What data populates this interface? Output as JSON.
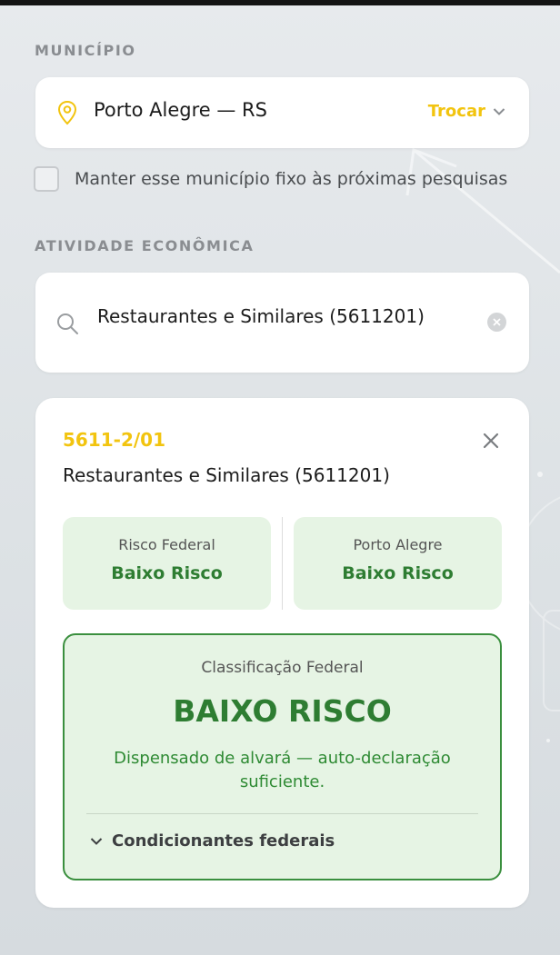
{
  "municipio": {
    "section_label": "MUNICÍPIO",
    "name": "Porto Alegre — RS",
    "change_label": "Trocar",
    "pin_icon": "location-pin-icon",
    "fix_label": "Manter esse município fixo às próximas pesquisas",
    "fix_checked": false
  },
  "atividade": {
    "section_label": "ATIVIDADE ECONÔMICA",
    "search_value": "Restaurantes e Similares (5611201)",
    "search_icon": "search-icon",
    "clear_icon": "clear-icon"
  },
  "result": {
    "code": "5611-2/01",
    "name": "Restaurantes e Similares (5611201)",
    "risks": [
      {
        "title": "Risco Federal",
        "value": "Baixo Risco"
      },
      {
        "title": "Porto Alegre",
        "value": "Baixo Risco"
      }
    ],
    "classification": {
      "title": "Classificação Federal",
      "level": "BAIXO RISCO",
      "description": "Dispensado de alvará — auto-declaração suficiente.",
      "conditions_label": "Condicionantes federais"
    }
  },
  "colors": {
    "accent": "#f2c40f",
    "success": "#2e7d32",
    "success_bg": "#e6f4e4"
  }
}
